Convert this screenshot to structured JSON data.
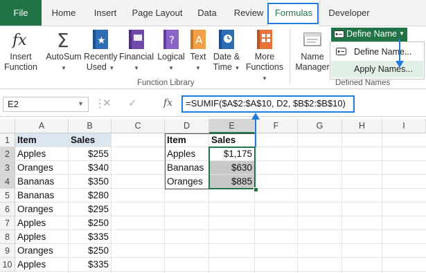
{
  "tabs": [
    "File",
    "Home",
    "Insert",
    "Page Layout",
    "Data",
    "Review",
    "Formulas",
    "Developer"
  ],
  "ribbon": {
    "insert_function": [
      "Insert",
      "Function"
    ],
    "autosum": "AutoSum",
    "recently_used": [
      "Recently",
      "Used"
    ],
    "financial": "Financial",
    "logical": "Logical",
    "text": "Text",
    "date_time": [
      "Date &",
      "Time"
    ],
    "more_functions": [
      "More",
      "Functions"
    ],
    "name_manager": [
      "Name",
      "Manager"
    ],
    "function_library_label": "Function Library",
    "defined_names_label": "Defined Names",
    "define_name_button": "Define Name",
    "menu": [
      "Define Name...",
      "Apply Names..."
    ]
  },
  "formula_bar": {
    "name_box": "E2",
    "fx": "fx",
    "formula": "=SUMIF($A$2:$A$10, D2, $B$2:$B$10)"
  },
  "columns": [
    "A",
    "B",
    "C",
    "D",
    "E",
    "F",
    "G",
    "H",
    "I"
  ],
  "rows": [
    "1",
    "2",
    "3",
    "4",
    "5",
    "6",
    "7",
    "8",
    "9",
    "10"
  ],
  "table_ab": {
    "headers": [
      "Item",
      "Sales"
    ],
    "rows": [
      [
        "Apples",
        "$255"
      ],
      [
        "Oranges",
        "$340"
      ],
      [
        "Bananas",
        "$350"
      ],
      [
        "Bananas",
        "$280"
      ],
      [
        "Oranges",
        "$295"
      ],
      [
        "Apples",
        "$250"
      ],
      [
        "Apples",
        "$335"
      ],
      [
        "Oranges",
        "$250"
      ],
      [
        "Apples",
        "$335"
      ]
    ]
  },
  "table_de": {
    "headers": [
      "Item",
      "Sales"
    ],
    "rows": [
      [
        "Apples",
        "$1,175"
      ],
      [
        "Bananas",
        "$630"
      ],
      [
        "Oranges",
        "$885"
      ]
    ]
  },
  "colors": {
    "excel_green": "#217346",
    "callout_blue": "#1f7bdc",
    "selection_gray": "#c8c8c8",
    "header_fill": "#dce6f1"
  }
}
